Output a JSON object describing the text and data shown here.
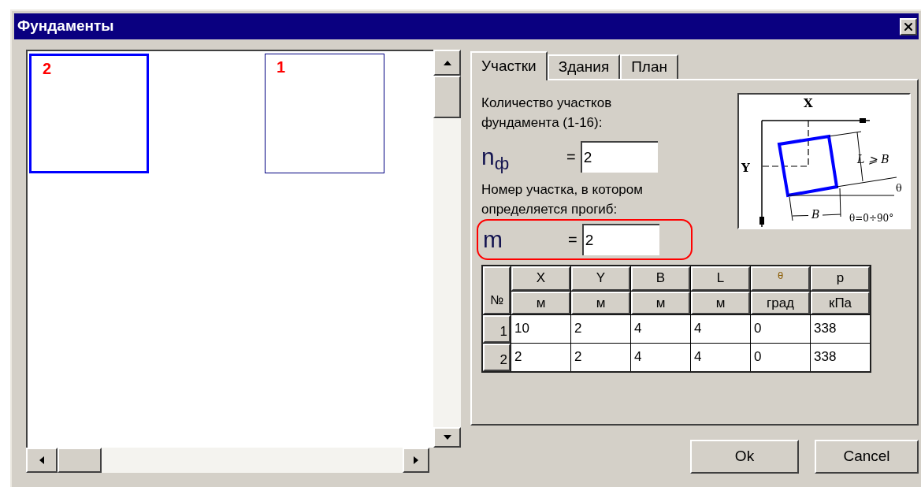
{
  "window": {
    "title": "Фундаменты"
  },
  "canvas": {
    "footings": [
      {
        "label": "2",
        "selected": true
      },
      {
        "label": "1",
        "selected": false
      }
    ]
  },
  "tabs": [
    {
      "label": "Участки",
      "selected": true
    },
    {
      "label": "Здания",
      "selected": false
    },
    {
      "label": "План",
      "selected": false
    }
  ],
  "count_label": "Количество участков фундамента (1-16):",
  "count_field": {
    "symbol": "n$_{ф}$",
    "equals": "=",
    "value": "2"
  },
  "deflection_label": "Номер участка, в котором определяется прогиб:",
  "deflection_field": {
    "symbol": "m",
    "equals": "=",
    "value": "2",
    "highlighted": true
  },
  "diagram": {
    "x_axis": "X",
    "y_axis": "Y",
    "length": "L ⩾ B",
    "angle": "θ",
    "width": "B",
    "range": "θ=0÷90°"
  },
  "table": {
    "corner": "№",
    "columns": [
      {
        "symbol": "X",
        "unit": "м"
      },
      {
        "symbol": "Y",
        "unit": "м"
      },
      {
        "symbol": "B",
        "unit": "м"
      },
      {
        "symbol": "L",
        "unit": "м"
      },
      {
        "symbol": "θ",
        "unit": "град"
      },
      {
        "symbol": "p",
        "unit": "кПа"
      }
    ],
    "rows": [
      {
        "index": "1",
        "cells": [
          "10",
          "2",
          "4",
          "4",
          "0",
          "338"
        ]
      },
      {
        "index": "2",
        "cells": [
          "2",
          "2",
          "4",
          "4",
          "0",
          "338"
        ]
      }
    ]
  },
  "buttons": [
    "Ok",
    "Cancel"
  ]
}
